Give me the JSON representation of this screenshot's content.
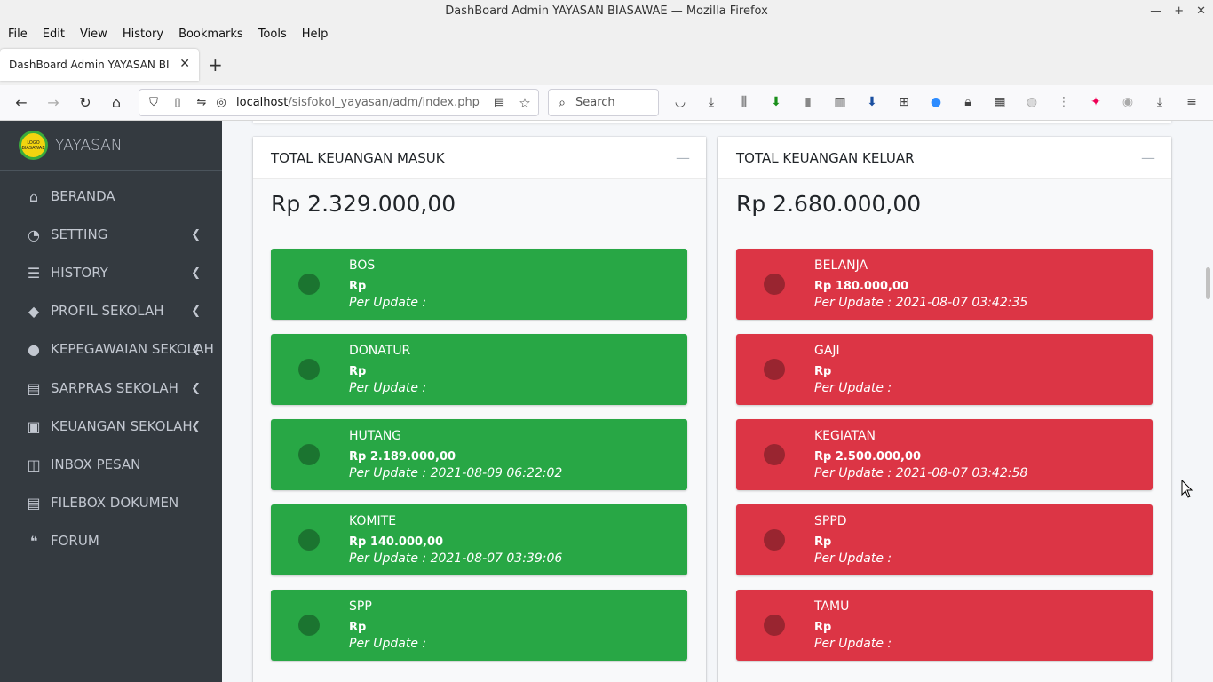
{
  "browser": {
    "window_title": "DashBoard Admin YAYASAN BIASAWAE — Mozilla Firefox",
    "menu": [
      "File",
      "Edit",
      "View",
      "History",
      "Bookmarks",
      "Tools",
      "Help"
    ],
    "tab_title": "DashBoard Admin YAYASAN BIASAWAE",
    "url_host": "localhost",
    "url_path": "/sisfokol_yayasan/adm/index.php",
    "search_placeholder": "Search"
  },
  "sidebar": {
    "logo_text": "LOGO BIASAWAE",
    "brand": "YAYASAN",
    "items": [
      {
        "label": "BERANDA",
        "icon": "home-icon",
        "has_children": false
      },
      {
        "label": "SETTING",
        "icon": "tachometer-icon",
        "has_children": true
      },
      {
        "label": "HISTORY",
        "icon": "list-icon",
        "has_children": true
      },
      {
        "label": "PROFIL SEKOLAH",
        "icon": "graduation-cap-icon",
        "has_children": true
      },
      {
        "label": "KEPEGAWAIAN SEKOLAH",
        "icon": "users-icon",
        "has_children": true
      },
      {
        "label": "SARPRAS SEKOLAH",
        "icon": "archive-icon",
        "has_children": true
      },
      {
        "label": "KEUANGAN SEKOLAH",
        "icon": "money-icon",
        "has_children": true
      },
      {
        "label": "INBOX PESAN",
        "icon": "inbox-icon",
        "has_children": false
      },
      {
        "label": "FILEBOX DOKUMEN",
        "icon": "archive-icon",
        "has_children": false
      },
      {
        "label": "FORUM",
        "icon": "comments-icon",
        "has_children": false
      }
    ]
  },
  "colors": {
    "income": "#28a745",
    "expense": "#dc3545",
    "sidebar": "#343a40"
  },
  "income_card": {
    "title": "TOTAL KEUANGAN MASUK",
    "total": "Rp 2.329.000,00",
    "items": [
      {
        "name": "BOS",
        "amount": "Rp",
        "update": "Per Update :"
      },
      {
        "name": "DONATUR",
        "amount": "Rp",
        "update": "Per Update :"
      },
      {
        "name": "HUTANG",
        "amount": "Rp 2.189.000,00",
        "update": "Per Update : 2021-08-09 06:22:02"
      },
      {
        "name": "KOMITE",
        "amount": "Rp 140.000,00",
        "update": "Per Update : 2021-08-07 03:39:06"
      },
      {
        "name": "SPP",
        "amount": "Rp",
        "update": "Per Update :"
      }
    ]
  },
  "expense_card": {
    "title": "TOTAL KEUANGAN KELUAR",
    "total": "Rp 2.680.000,00",
    "items": [
      {
        "name": "BELANJA",
        "amount": "Rp 180.000,00",
        "update": "Per Update : 2021-08-07 03:42:35"
      },
      {
        "name": "GAJI",
        "amount": "Rp",
        "update": "Per Update :"
      },
      {
        "name": "KEGIATAN",
        "amount": "Rp 2.500.000,00",
        "update": "Per Update : 2021-08-07 03:42:58"
      },
      {
        "name": "SPPD",
        "amount": "Rp",
        "update": "Per Update :"
      },
      {
        "name": "TAMU",
        "amount": "Rp",
        "update": "Per Update :"
      }
    ]
  }
}
